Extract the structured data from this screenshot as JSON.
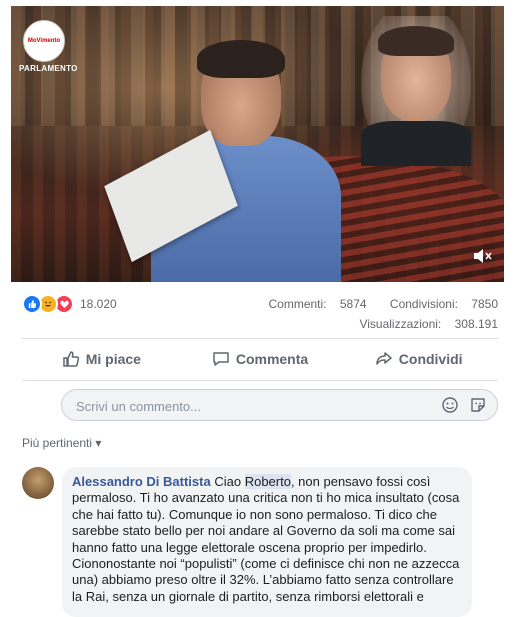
{
  "video": {
    "logo_text": "MoVimento",
    "logo_caption": "PARLAMENTO",
    "mute_icon": "speaker-muted-icon"
  },
  "reactions": {
    "icons": [
      "like-icon",
      "haha-icon",
      "love-icon"
    ],
    "count": "18.020"
  },
  "stats": {
    "comments_label": "Commenti:",
    "comments": "5874",
    "shares_label": "Condivisioni:",
    "shares": "7850",
    "views_label": "Visualizzazioni:",
    "views": "308.191"
  },
  "actions": {
    "like": "Mi piace",
    "comment": "Commenta",
    "share": "Condividi"
  },
  "comment_input": {
    "placeholder": "Scrivi un commento..."
  },
  "sort": {
    "label": "Più pertinenti"
  },
  "comment": {
    "author": "Alessandro Di Battista",
    "greeting": "Ciao",
    "mention": "Roberto",
    "text": ", non pensavo fossi così permaloso. Ti ho avanzato una critica non ti ho mica insultato (cosa che hai fatto tu). Comunque io non sono permaloso. Ti dico che sarebbe stato bello per noi andare al Governo da soli ma come sai hanno fatto una legge elettorale oscena proprio per impedirlo. Ciononostante noi “populisti” (come ci definisce chi non ne azzecca una) abbiamo preso oltre il 32%. L’abbiamo fatto senza controllare la Rai, senza un giornale di partito, senza rimborsi elettorali e"
  },
  "colors": {
    "link": "#385898",
    "like_blue": "#1877f2",
    "text_secondary": "#65676b"
  }
}
